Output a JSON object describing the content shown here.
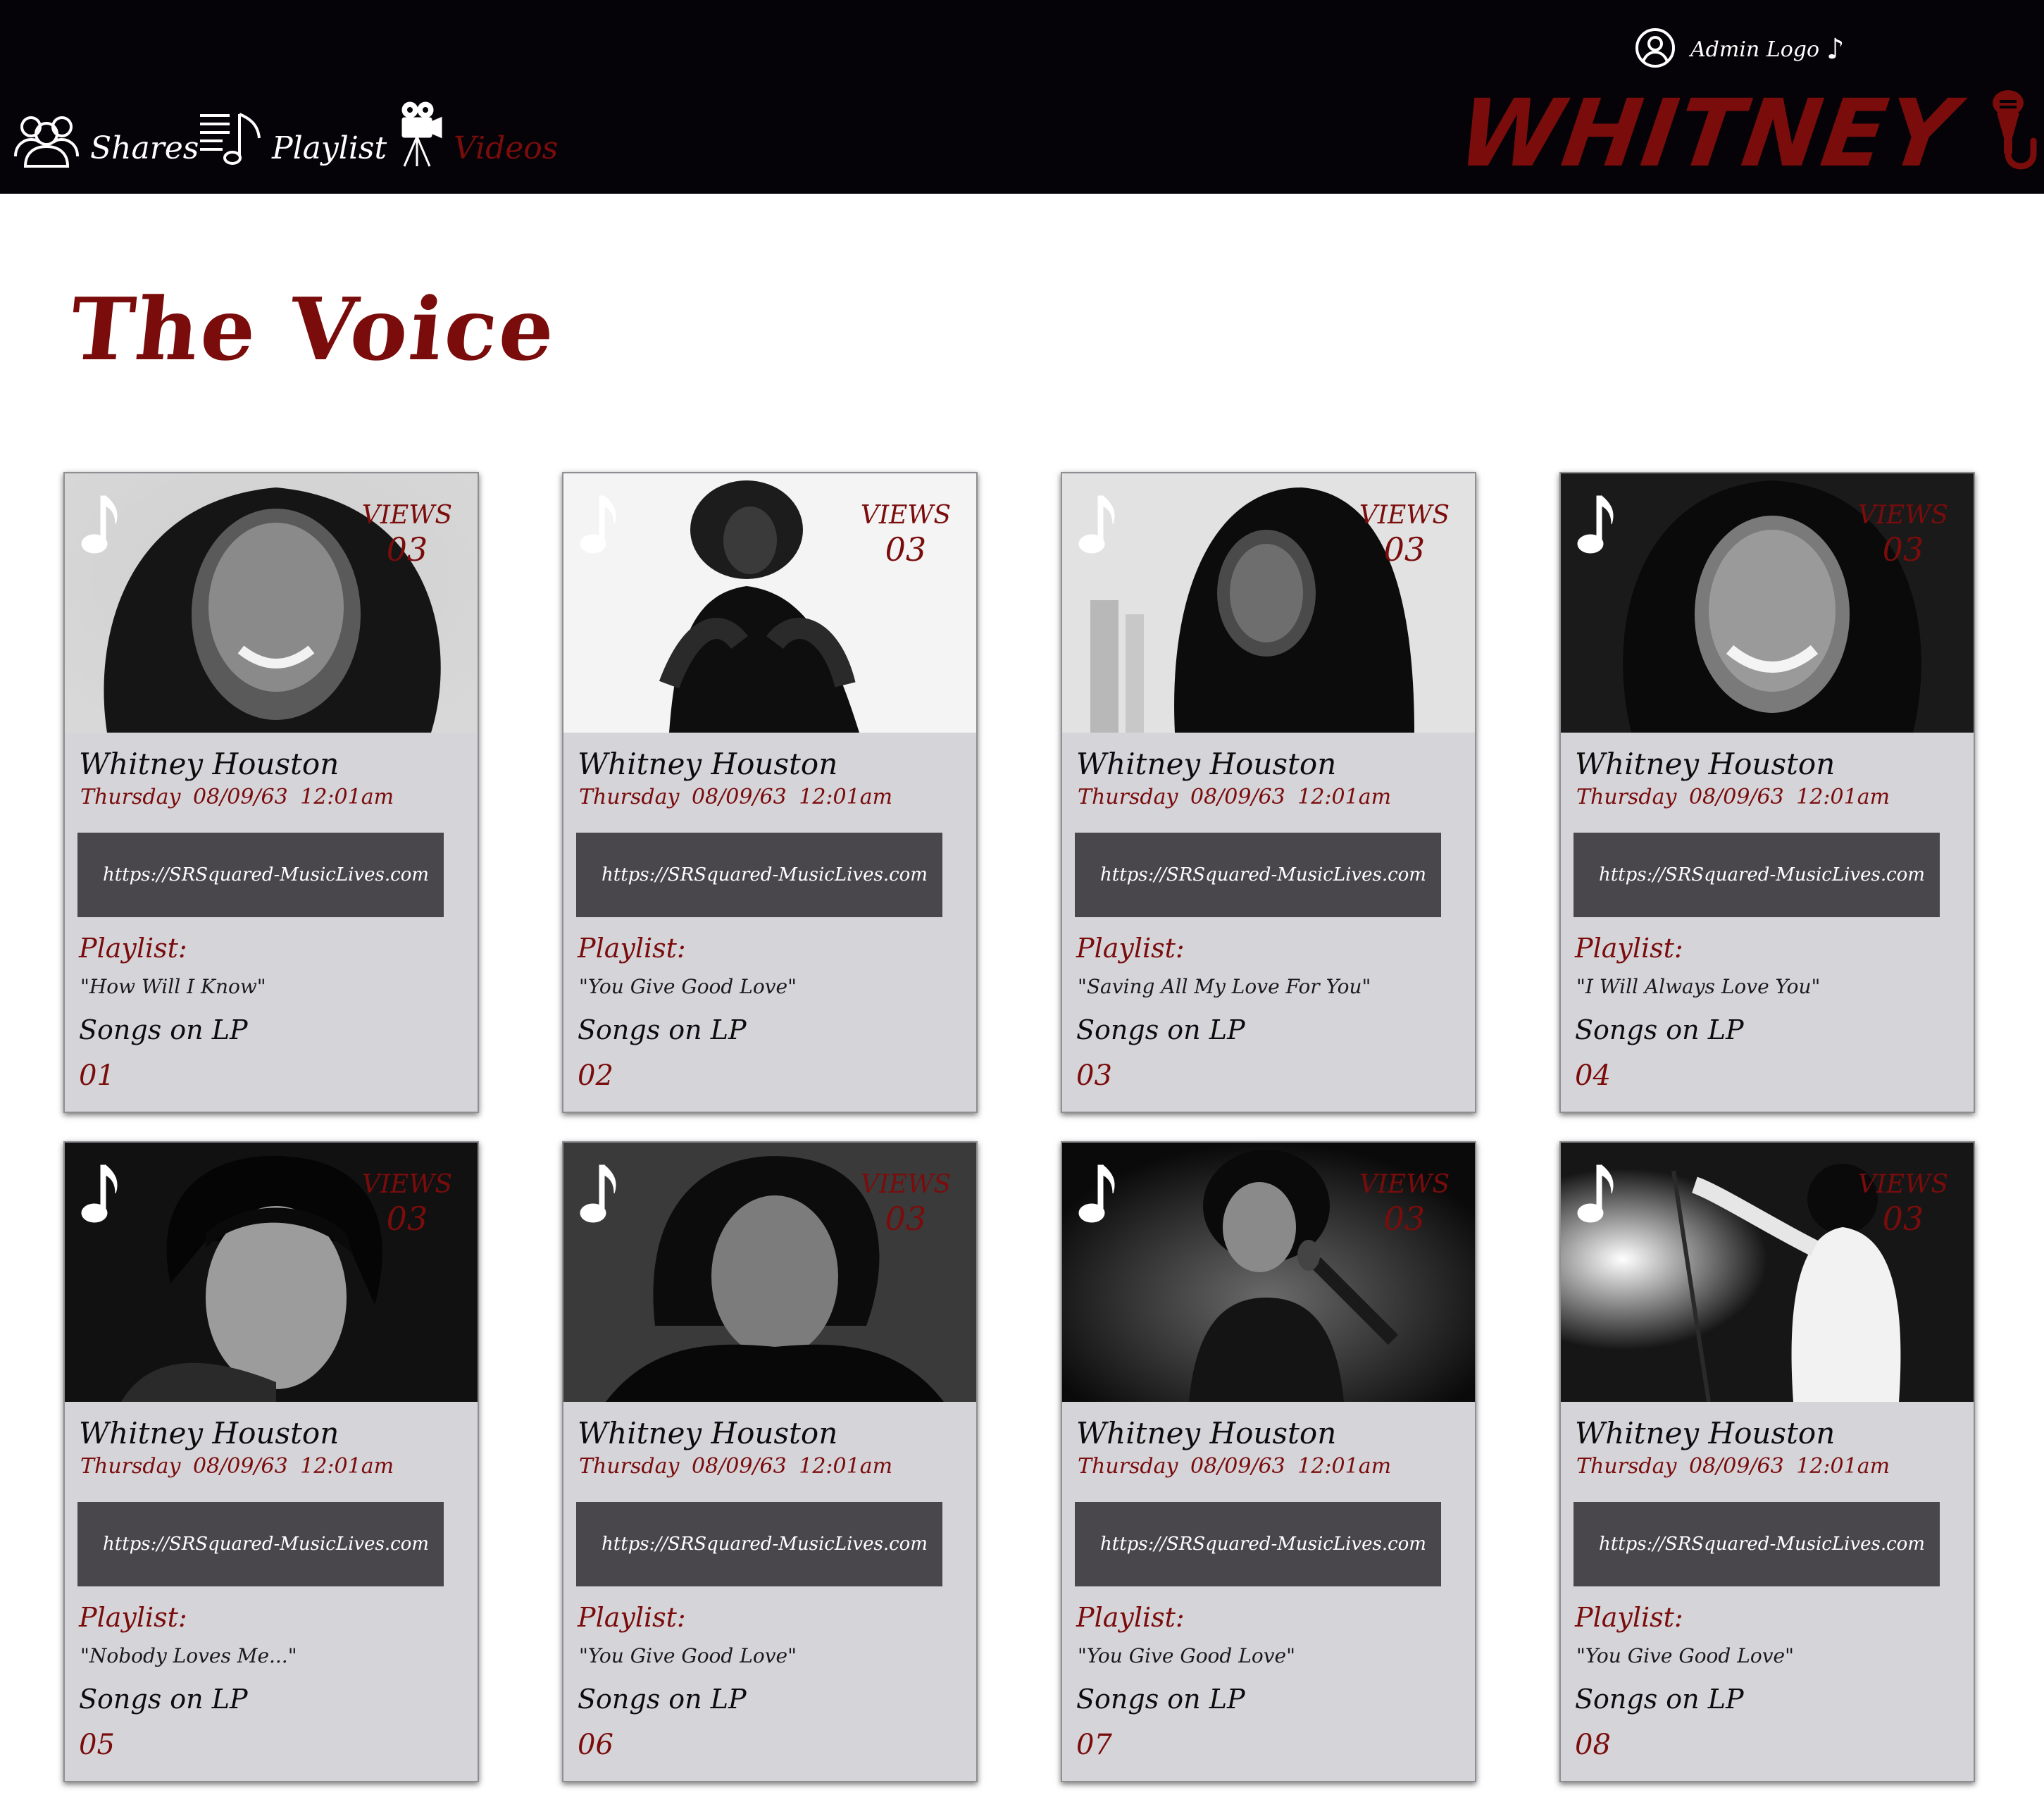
{
  "nav": {
    "items": [
      {
        "label": "Shares",
        "icon": "users-icon"
      },
      {
        "label": "Playlist",
        "icon": "playlist-icon"
      },
      {
        "label": "Videos",
        "icon": "video-camera-icon",
        "active": true
      }
    ]
  },
  "header": {
    "admin_label": "Admin Logo",
    "admin_note": "♪",
    "brand": "WHITNEY",
    "brand_icon": "microphone-icon"
  },
  "page": {
    "title": "The Voice"
  },
  "colors": {
    "accent": "#7a0c0c",
    "header_bg": "#050307",
    "card_bg": "#d5d4d9",
    "url_box": "#49474c"
  },
  "cards": [
    {
      "artist": "Whitney Houston",
      "datetime": "Thursday  08/09/63  12:01am",
      "url": "https://SRSquared-MusicLives.com",
      "views_label": "VIEWS",
      "views": "03",
      "playlist_label": "Playlist:",
      "playlist_song": "\"How Will I Know\"",
      "songs_label": "Songs on LP",
      "song_number": "01"
    },
    {
      "artist": "Whitney Houston",
      "datetime": "Thursday  08/09/63  12:01am",
      "url": "https://SRSquared-MusicLives.com",
      "views_label": "VIEWS",
      "views": "03",
      "playlist_label": "Playlist:",
      "playlist_song": "\"You Give Good Love\"",
      "songs_label": "Songs on LP",
      "song_number": "02"
    },
    {
      "artist": "Whitney Houston",
      "datetime": "Thursday  08/09/63  12:01am",
      "url": "https://SRSquared-MusicLives.com",
      "views_label": "VIEWS",
      "views": "03",
      "playlist_label": "Playlist:",
      "playlist_song": "\"Saving All My Love For You\"",
      "songs_label": "Songs on LP",
      "song_number": "03"
    },
    {
      "artist": "Whitney Houston",
      "datetime": "Thursday  08/09/63  12:01am",
      "url": "https://SRSquared-MusicLives.com",
      "views_label": "VIEWS",
      "views": "03",
      "playlist_label": "Playlist:",
      "playlist_song": "\"I Will Always Love You\"",
      "songs_label": "Songs on LP",
      "song_number": "04"
    },
    {
      "artist": "Whitney Houston",
      "datetime": "Thursday  08/09/63  12:01am",
      "url": "https://SRSquared-MusicLives.com",
      "views_label": "VIEWS",
      "views": "03",
      "playlist_label": "Playlist:",
      "playlist_song": "\"Nobody Loves Me...\"",
      "songs_label": "Songs on LP",
      "song_number": "05"
    },
    {
      "artist": "Whitney Houston",
      "datetime": "Thursday  08/09/63  12:01am",
      "url": "https://SRSquared-MusicLives.com",
      "views_label": "VIEWS",
      "views": "03",
      "playlist_label": "Playlist:",
      "playlist_song": "\"You Give Good Love\"",
      "songs_label": "Songs on LP",
      "song_number": "06"
    },
    {
      "artist": "Whitney Houston",
      "datetime": "Thursday  08/09/63  12:01am",
      "url": "https://SRSquared-MusicLives.com",
      "views_label": "VIEWS",
      "views": "03",
      "playlist_label": "Playlist:",
      "playlist_song": "\"You Give Good Love\"",
      "songs_label": "Songs on LP",
      "song_number": "07"
    },
    {
      "artist": "Whitney Houston",
      "datetime": "Thursday  08/09/63  12:01am",
      "url": "https://SRSquared-MusicLives.com",
      "views_label": "VIEWS",
      "views": "03",
      "playlist_label": "Playlist:",
      "playlist_song": "\"You Give Good Love\"",
      "songs_label": "Songs on LP",
      "song_number": "08"
    }
  ]
}
